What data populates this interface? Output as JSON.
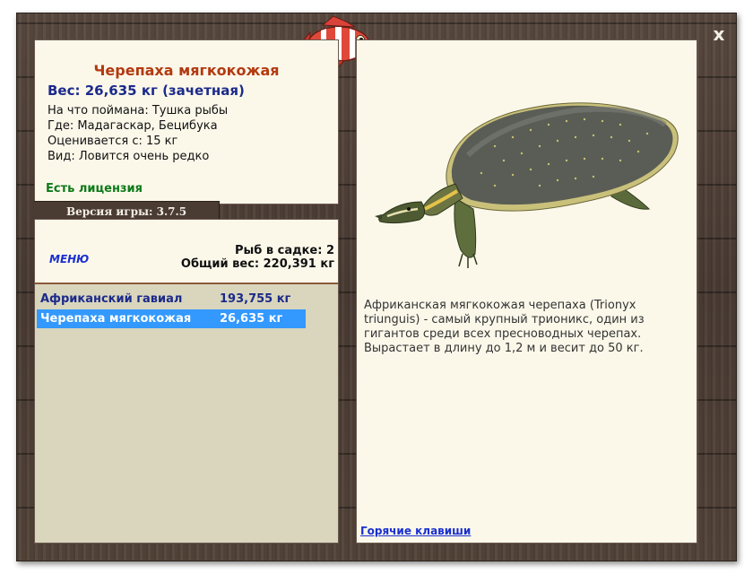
{
  "window": {
    "close_label": "x"
  },
  "fish_card": {
    "title": "Черепаха мягкокожая",
    "weight": "Вес: 26,635 кг (зачетная)",
    "caught_on": "На что поймана: Тушка рыбы",
    "location": "Где: Мадагаскар, Бецибука",
    "valued_from": "Оценивается с: 15 кг",
    "rarity": "Вид: Ловится очень редко",
    "license": "Есть лицензия"
  },
  "version_label": "Версия игры: 3.7.5",
  "keepnet": {
    "menu_label": "МЕНЮ",
    "count_label": "Рыб в садке: 2",
    "total_weight_label": "Общий вес: 220,391 кг",
    "rows": [
      {
        "name": "Африканский гавиал",
        "weight": "193,755 кг"
      },
      {
        "name": "Черепаха мягкокожая",
        "weight": "26,635 кг"
      }
    ]
  },
  "description": "Африканская мягкокожая черепаха (Trionyx triunguis) - самый крупный трионикс, один из гигантов среди всех пресноводных черепах. Вырастает в длину до 1,2 м и весит до 50 кг.",
  "hotkeys_label": "Горячие клавиши",
  "colors": {
    "accent_title": "#b33a10",
    "weight_blue": "#1c2a8a",
    "license_green": "#0d7a19",
    "selection": "#3399ff",
    "link": "#1a2fd0"
  },
  "icons": {
    "logo": "striped-fish-icon",
    "close": "close-icon",
    "picture": "softshell-turtle-image"
  }
}
